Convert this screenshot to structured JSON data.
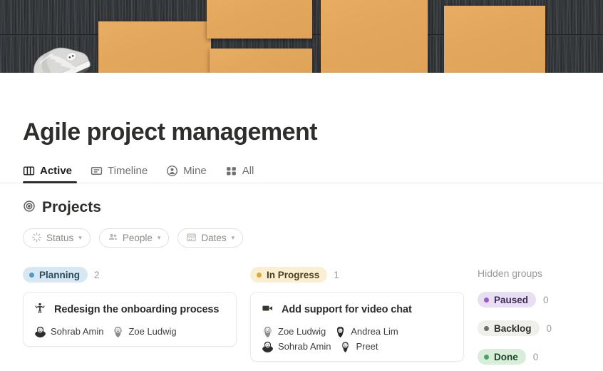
{
  "banner": {
    "name": "project-cover-image",
    "description": "dark wood background with tan paper sheets and a grey sneaker"
  },
  "header": {
    "title": "Agile project management"
  },
  "tabs": [
    {
      "label": "Active",
      "icon": "board-columns-icon",
      "active": true
    },
    {
      "label": "Timeline",
      "icon": "timeline-icon",
      "active": false
    },
    {
      "label": "Mine",
      "icon": "person-circle-icon",
      "active": false
    },
    {
      "label": "All",
      "icon": "grid-icon",
      "active": false
    }
  ],
  "section": {
    "icon": "target-icon",
    "title": "Projects"
  },
  "filters": [
    {
      "label": "Status",
      "icon": "status-spinner-icon",
      "chevron": "⌄"
    },
    {
      "label": "People",
      "icon": "people-icon",
      "chevron": "⌄"
    },
    {
      "label": "Dates",
      "icon": "calendar-icon",
      "chevron": "⌄"
    }
  ],
  "columns": [
    {
      "status": "Planning",
      "count": "2",
      "pill_bg": "#D7E8F3",
      "pill_text": "#2B4A5E",
      "dot_color": "#4C9BC8",
      "cards": [
        {
          "icon": "person-raised-arms-icon",
          "title": "Redesign the onboarding process",
          "assignees": [
            {
              "name": "Sohrab Amin",
              "avatar": "avatar-sohrab-amin"
            },
            {
              "name": "Zoe Ludwig",
              "avatar": "avatar-zoe-ludwig"
            }
          ]
        }
      ]
    },
    {
      "status": "In Progress",
      "count": "1",
      "pill_bg": "#FAEFD2",
      "pill_text": "#4A3D1C",
      "dot_color": "#E0A93B",
      "cards": [
        {
          "icon": "video-camera-icon",
          "title": "Add support for video chat",
          "assignees": [
            {
              "name": "Zoe Ludwig",
              "avatar": "avatar-zoe-ludwig"
            },
            {
              "name": "Andrea Lim",
              "avatar": "avatar-andrea-lim"
            },
            {
              "name": "Sohrab Amin",
              "avatar": "avatar-sohrab-amin"
            },
            {
              "name": "Preet",
              "avatar": "avatar-preet"
            }
          ]
        }
      ]
    }
  ],
  "hidden_groups": {
    "title": "Hidden groups",
    "items": [
      {
        "label": "Paused",
        "count": "0",
        "pill_bg": "#E9DFF5",
        "pill_text": "#3D2A55",
        "dot_color": "#9B59C9"
      },
      {
        "label": "Backlog",
        "count": "0",
        "pill_bg": "#EFEFEC",
        "pill_text": "#2E2E2C",
        "dot_color": "#6F6F6D"
      },
      {
        "label": "Done",
        "count": "0",
        "pill_bg": "#D8EEDB",
        "pill_text": "#1F4429",
        "dot_color": "#4BA463"
      }
    ]
  }
}
